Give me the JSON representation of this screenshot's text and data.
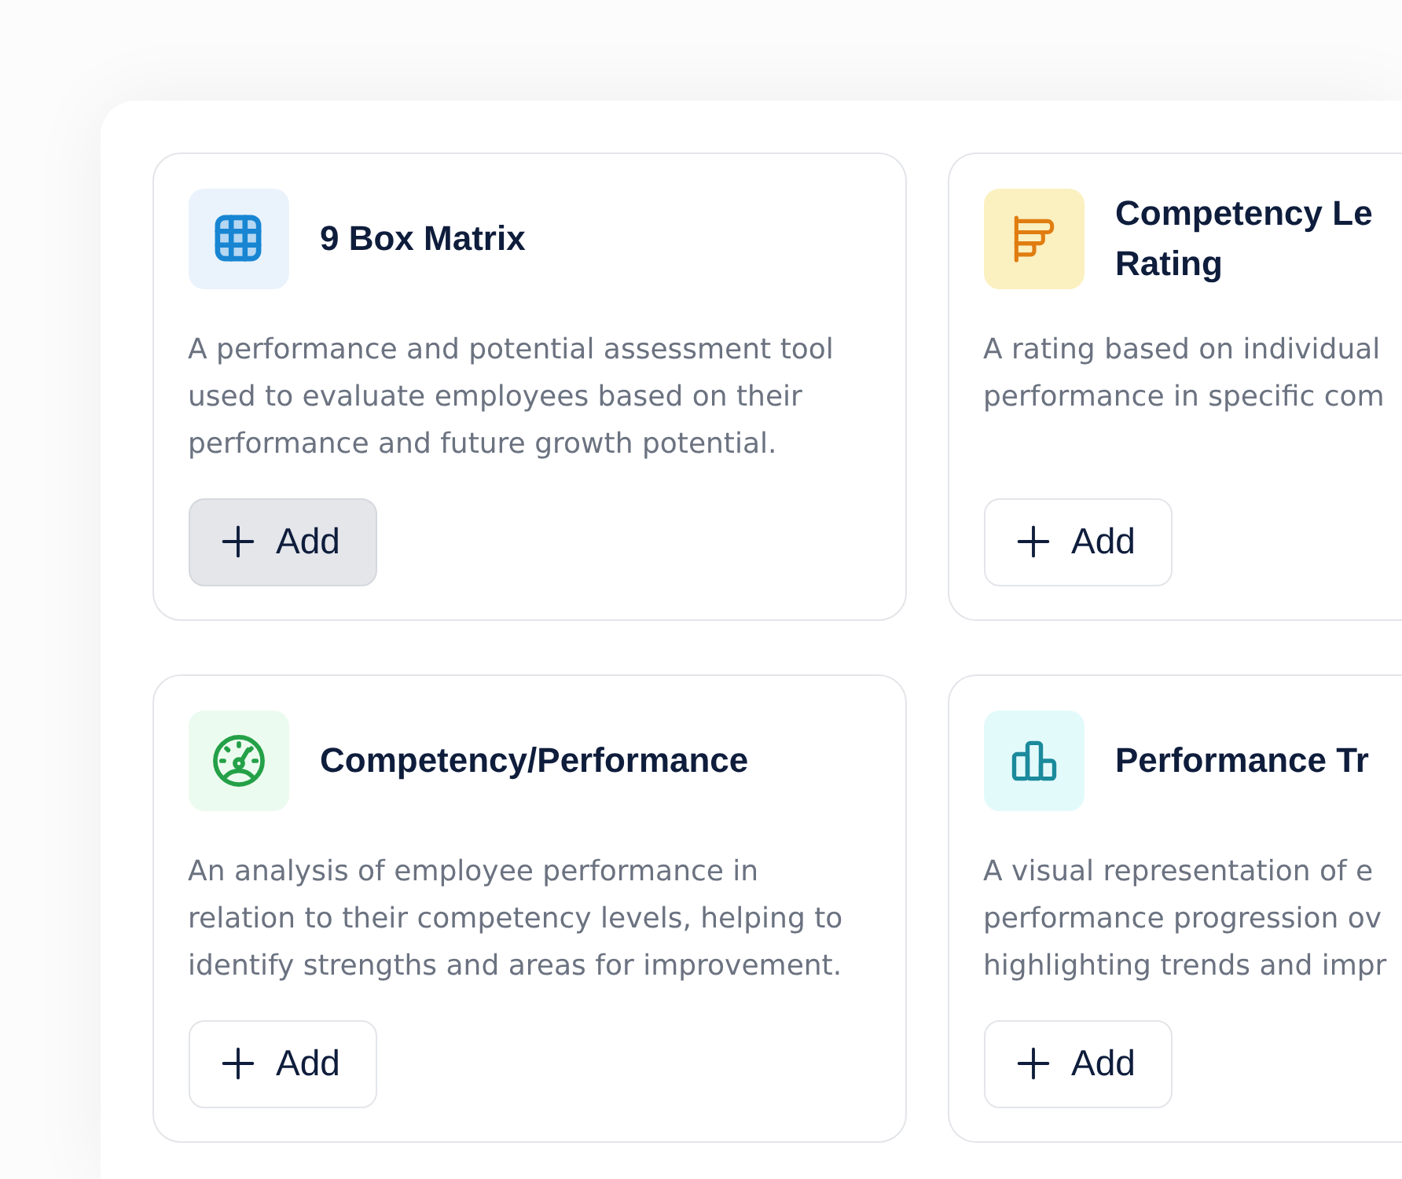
{
  "rows": [
    {
      "cards": [
        {
          "title_lines": [
            "9 Box Matrix"
          ],
          "description_lines": [
            "A performance and potential assessment tool",
            "used to evaluate employees based on their",
            "performance and future growth potential."
          ],
          "color": "#1785d2",
          "tile": {
            "color": "#eaf3fc"
          },
          "add_button": {
            "label": "Add",
            "highlighted": true
          }
        },
        {
          "title_lines": [
            "Competency Le",
            "Rating"
          ],
          "description_lines": [
            "A rating based on individual",
            "performance in specific com"
          ],
          "color": "#e07d10",
          "tile": {
            "color": "#fbf0c0"
          },
          "add_button": {
            "label": "Add",
            "highlighted": false
          }
        }
      ]
    },
    {
      "cards": [
        {
          "title_lines": [
            "Competency/Performance"
          ],
          "description_lines": [
            "An analysis of employee performance in",
            "relation to their competency levels, helping to",
            "identify strengths and areas for improvement."
          ],
          "color": "#24a148",
          "tile": {
            "color": "#ecfbef"
          },
          "add_button": {
            "label": "Add",
            "highlighted": false
          }
        },
        {
          "title_lines": [
            "Performance Tr"
          ],
          "description_lines": [
            "A visual representation of e",
            "performance progression ov",
            "highlighting trends and impr"
          ],
          "color": "#1b8a9c",
          "tile": {
            "color": "#e3fafb"
          },
          "add_button": {
            "label": "Add",
            "highlighted": false
          }
        }
      ]
    }
  ]
}
